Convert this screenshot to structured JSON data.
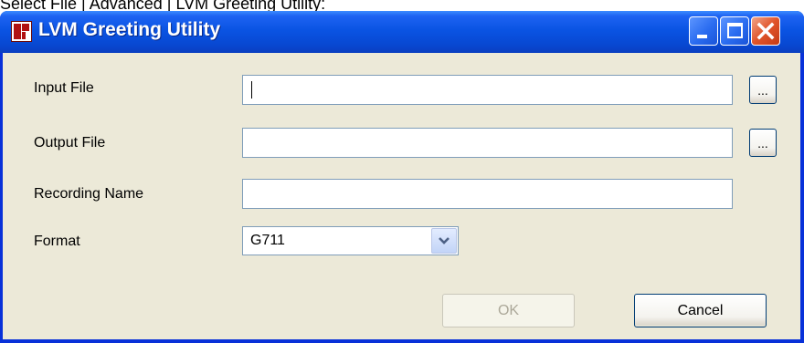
{
  "caption": "Select File | Advanced | LVM Greeting Utility:",
  "window": {
    "title": "LVM Greeting Utility",
    "icon": "app-logo-icon",
    "controls": {
      "minimize": "minimize-icon",
      "maximize": "maximize-icon",
      "close": "close-icon"
    }
  },
  "form": {
    "input_file": {
      "label": "Input File",
      "value": "",
      "browse_label": "..."
    },
    "output_file": {
      "label": "Output File",
      "value": "",
      "browse_label": "..."
    },
    "recording_name": {
      "label": "Recording Name",
      "value": ""
    },
    "format": {
      "label": "Format",
      "selected": "G711"
    }
  },
  "buttons": {
    "ok": "OK",
    "cancel": "Cancel"
  },
  "colors": {
    "titlebar": "#0a54e3",
    "client": "#ece9d8",
    "close_button": "#e0542a",
    "disabled_text": "#aca899"
  }
}
